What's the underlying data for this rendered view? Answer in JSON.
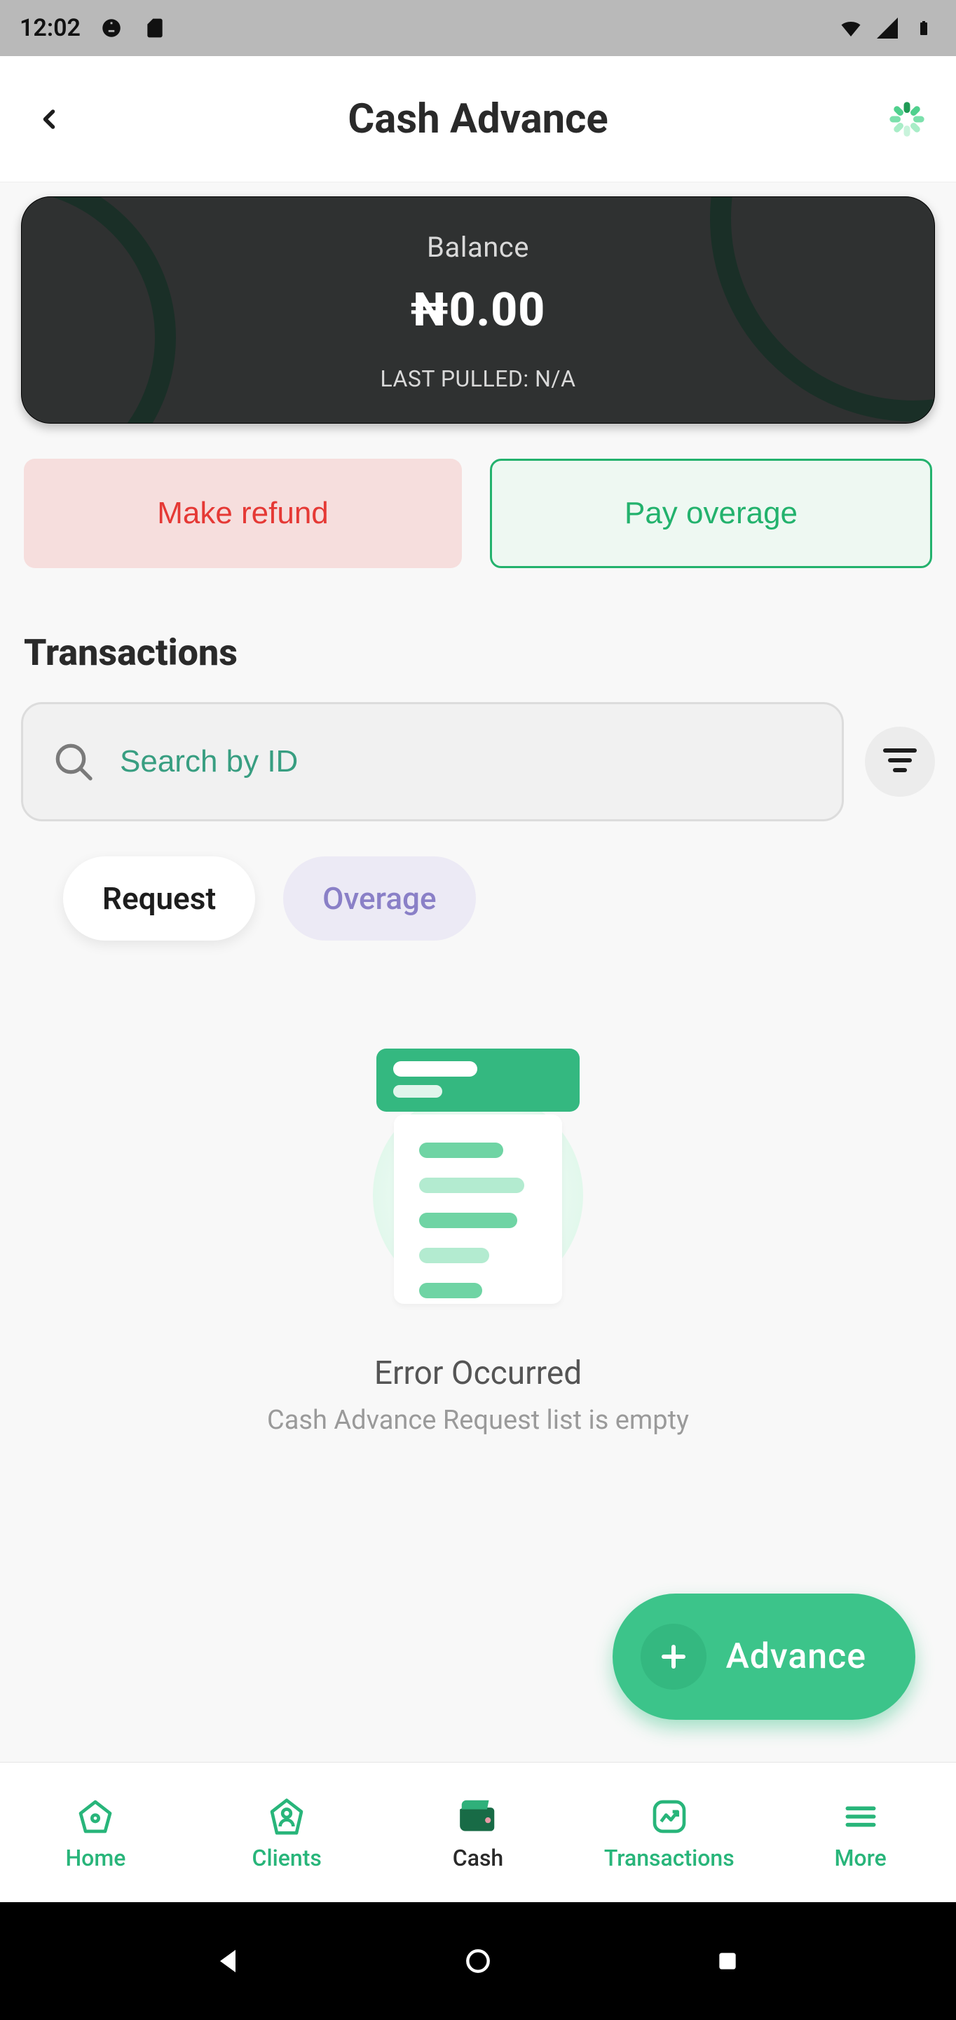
{
  "statusbar": {
    "time": "12:02"
  },
  "header": {
    "title": "Cash Advance"
  },
  "balance": {
    "label": "Balance",
    "amount": "₦0.00",
    "last_pulled": "LAST PULLED: N/A"
  },
  "actions": {
    "refund_label": "Make refund",
    "pay_overage_label": "Pay overage"
  },
  "transactions": {
    "section_title": "Transactions",
    "search_placeholder": "Search by ID",
    "tabs": {
      "request": "Request",
      "overage": "Overage",
      "active": "request"
    }
  },
  "empty_state": {
    "title": "Error Occurred",
    "subtitle": "Cash Advance Request list is empty"
  },
  "fab": {
    "label": "Advance"
  },
  "bottom_nav": {
    "items": [
      {
        "label": "Home"
      },
      {
        "label": "Clients"
      },
      {
        "label": "Cash"
      },
      {
        "label": "Transactions"
      },
      {
        "label": "More"
      }
    ],
    "active_index": 2
  },
  "colors": {
    "primary": "#34b880",
    "danger": "#e53935",
    "card_bg": "#2f3131"
  }
}
